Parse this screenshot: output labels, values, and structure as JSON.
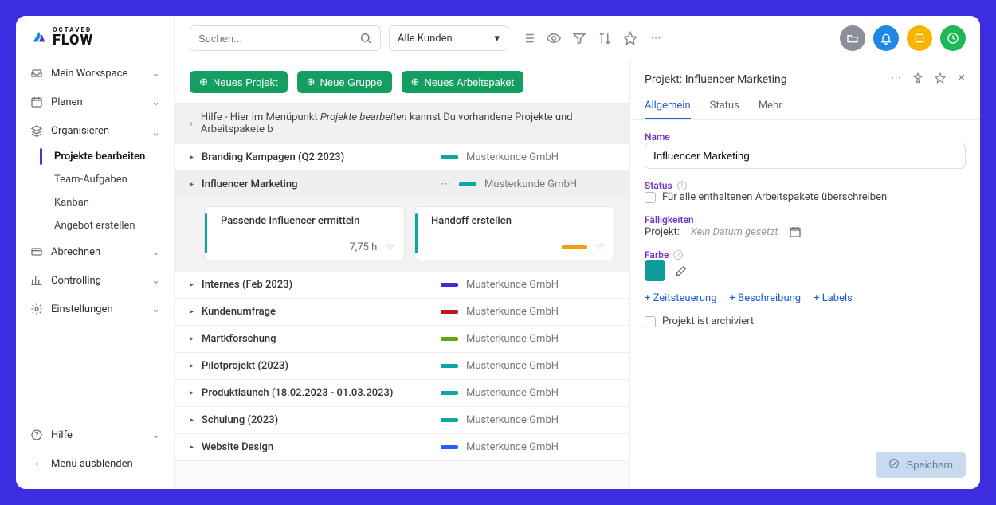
{
  "brand": {
    "small": "OCTAVED",
    "big": "FLOW"
  },
  "sidebar": {
    "workspace": "Mein Workspace",
    "plan": "Planen",
    "organize": "Organisieren",
    "sub": {
      "edit_projects": "Projekte bearbeiten",
      "team_tasks": "Team-Aufgaben",
      "kanban": "Kanban",
      "quote": "Angebot erstellen"
    },
    "billing": "Abrechnen",
    "controlling": "Controlling",
    "settings": "Einstellungen",
    "help": "Hilfe",
    "hide_menu": "Menü ausblenden"
  },
  "topbar": {
    "search_placeholder": "Suchen...",
    "customers": "Alle Kunden"
  },
  "actions": {
    "new_project": "Neues Projekt",
    "new_group": "Neue Gruppe",
    "new_workpackage": "Neues Arbeitspaket"
  },
  "help_line": {
    "prefix": "Hilfe - Hier im Menüpunkt ",
    "em": "Projekte bearbeiten",
    "suffix": " kannst Du vorhandene Projekte und Arbeitspakete b"
  },
  "projects": [
    {
      "name": "Branding Kampagen (Q2 2023)",
      "customer": "Musterkunde GmbH",
      "color": "#0ea5a5"
    },
    {
      "name": "Influencer Marketing",
      "customer": "Musterkunde GmbH",
      "color": "#0ea5a5",
      "selected": true
    },
    {
      "name": "Internes (Feb 2023)",
      "customer": "Musterkunde GmbH",
      "color": "#3b2fd6"
    },
    {
      "name": "Kundenumfrage",
      "customer": "Musterkunde GmbH",
      "color": "#b91c1c"
    },
    {
      "name": "Martkforschung",
      "customer": "Musterkunde GmbH",
      "color": "#65a30d"
    },
    {
      "name": "Pilotprojekt (2023)",
      "customer": "Musterkunde GmbH",
      "color": "#0ea5a5"
    },
    {
      "name": "Produktlaunch (18.02.2023 - 01.03.2023)",
      "customer": "Musterkunde GmbH",
      "color": "#0ea5a5"
    },
    {
      "name": "Schulung (2023)",
      "customer": "Musterkunde GmbH",
      "color": "#0ea5a5"
    },
    {
      "name": "Website Design",
      "customer": "Musterkunde GmbH",
      "color": "#2563eb"
    }
  ],
  "cards": [
    {
      "title": "Passende Influencer ermitteln",
      "hours": "7,75 h"
    },
    {
      "title": "Handoff erstellen",
      "bar_color": "#f59e0b"
    }
  ],
  "details": {
    "title_prefix": "Projekt: ",
    "title_name": "Influencer Marketing",
    "tabs": {
      "general": "Allgemein",
      "status": "Status",
      "more": "Mehr"
    },
    "labels": {
      "name": "Name",
      "status": "Status",
      "status_override": "Für alle enthaltenen Arbeitspakete überschreiben",
      "due": "Fälligkeiten",
      "project": "Projekt:",
      "no_date": "Kein Datum gesetzt",
      "color": "Farbe",
      "archived": "Projekt ist archiviert"
    },
    "name_value": "Influencer Marketing",
    "add": {
      "time": "+ Zeitsteuerung",
      "desc": "+ Beschreibung",
      "labels": "+ Labels"
    },
    "save": "Speichern"
  }
}
